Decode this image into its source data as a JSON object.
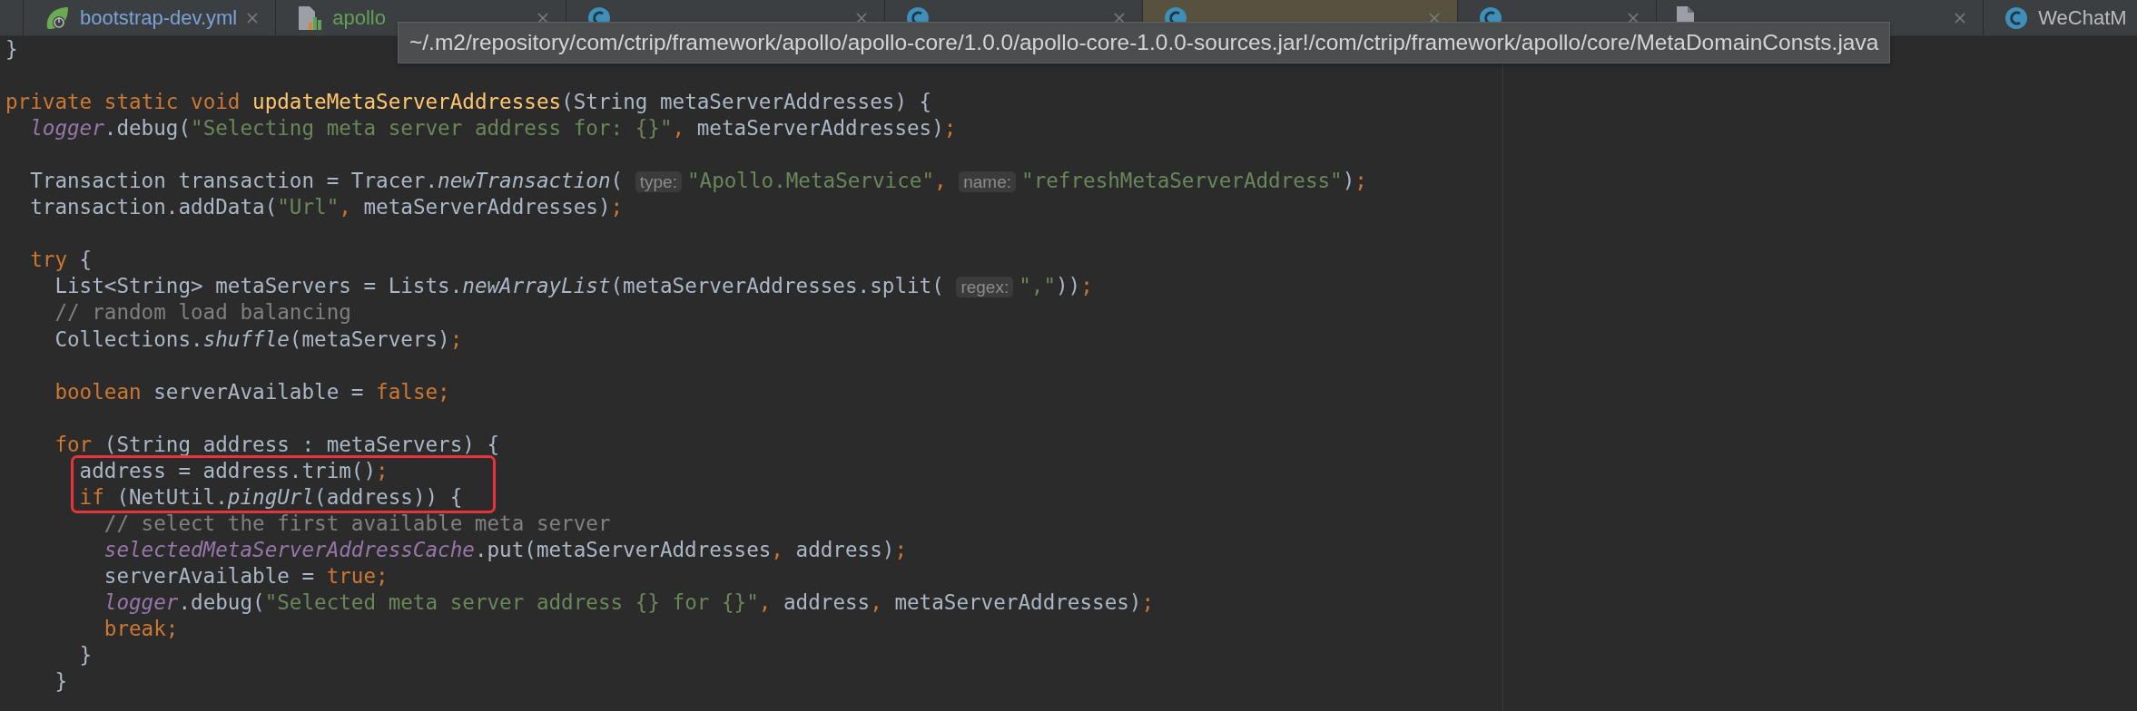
{
  "tabs": [
    {
      "label": "bootstrap-dev.yml",
      "kind": "spring",
      "color": "#7aa2d6",
      "selected": false
    },
    {
      "label": "apollo",
      "kind": "properties",
      "color": "#62a05a",
      "selected": false
    },
    {
      "kind": "class",
      "selected": false
    },
    {
      "kind": "class",
      "selected": false
    },
    {
      "kind": "class",
      "selected": true
    },
    {
      "kind": "class",
      "selected": false
    },
    {
      "kind": "xml",
      "selected": false
    },
    {
      "label": "WeChatM",
      "kind": "class",
      "color": "#bbbbbb",
      "selected": false
    }
  ],
  "tooltip": {
    "text": "~/.m2/repository/com/ctrip/framework/apollo/apollo-core/1.0.0/apollo-core-1.0.0-sources.jar!/com/ctrip/framework/apollo/core/MetaDomainConsts.java"
  },
  "code": {
    "lines": [
      {
        "highlighted": false,
        "tokens": [
          {
            "kind": "plain",
            "text": "}"
          }
        ]
      },
      {
        "highlighted": false
      },
      {
        "highlighted": false,
        "tokens": [
          {
            "kind": "kw",
            "text": "private static void "
          },
          {
            "kind": "decl",
            "text": "updateMetaServerAddresses"
          },
          {
            "kind": "plain",
            "text": "(String metaServerAddresses) {"
          }
        ],
        "children": [
          {
            "highlighted": false,
            "tokens": [
              {
                "kind": "field",
                "text": "logger"
              },
              {
                "kind": "plain",
                "text": ".debug("
              },
              {
                "kind": "str",
                "text": "\"Selecting meta server address for: {}\""
              },
              {
                "kind": "kw",
                "text": ", "
              },
              {
                "kind": "plain",
                "text": "metaServerAddresses)"
              },
              {
                "kind": "kw",
                "text": ";"
              }
            ]
          },
          {
            "highlighted": false
          },
          {
            "highlighted": false,
            "tokens": [
              {
                "kind": "plain",
                "text": "Transaction transaction = Tracer."
              },
              {
                "kind": "static",
                "text": "newTransaction"
              },
              {
                "kind": "plain",
                "text": "( "
              },
              {
                "kind": "hint",
                "text": "type:"
              },
              {
                "kind": "str",
                "text": "\"Apollo.MetaService\""
              },
              {
                "kind": "kw",
                "text": ", "
              },
              {
                "kind": "hint",
                "text": "name:"
              },
              {
                "kind": "str",
                "text": "\"refreshMetaServerAddress\""
              },
              {
                "kind": "plain",
                "text": ")"
              },
              {
                "kind": "kw",
                "text": ";"
              }
            ]
          },
          {
            "highlighted": false,
            "tokens": [
              {
                "kind": "plain",
                "text": "transaction.addData("
              },
              {
                "kind": "str",
                "text": "\"Url\""
              },
              {
                "kind": "kw",
                "text": ", "
              },
              {
                "kind": "plain",
                "text": "metaServerAddresses)"
              },
              {
                "kind": "kw",
                "text": ";"
              }
            ]
          },
          {
            "highlighted": false
          },
          {
            "highlighted": false,
            "tokens": [
              {
                "kind": "kw",
                "text": "try "
              },
              {
                "kind": "plain",
                "text": "{"
              }
            ],
            "children": [
              {
                "highlighted": false,
                "tokens": [
                  {
                    "kind": "plain",
                    "text": "List<String> metaServers = Lists."
                  },
                  {
                    "kind": "static",
                    "text": "newArrayList"
                  },
                  {
                    "kind": "plain",
                    "text": "(metaServerAddresses.split( "
                  },
                  {
                    "kind": "hint",
                    "text": "regex:"
                  },
                  {
                    "kind": "str",
                    "text": "\",\""
                  },
                  {
                    "kind": "plain",
                    "text": "))"
                  },
                  {
                    "kind": "kw",
                    "text": ";"
                  }
                ]
              },
              {
                "highlighted": false,
                "tokens": [
                  {
                    "kind": "comment",
                    "text": "// random load balancing"
                  }
                ]
              },
              {
                "highlighted": false,
                "tokens": [
                  {
                    "kind": "plain",
                    "text": "Collections."
                  },
                  {
                    "kind": "static",
                    "text": "shuffle"
                  },
                  {
                    "kind": "plain",
                    "text": "(metaServers)"
                  },
                  {
                    "kind": "kw",
                    "text": ";"
                  }
                ]
              },
              {
                "highlighted": false
              },
              {
                "highlighted": false,
                "tokens": [
                  {
                    "kind": "kw",
                    "text": "boolean "
                  },
                  {
                    "kind": "plain",
                    "text": "serverAvailable = "
                  },
                  {
                    "kind": "kw",
                    "text": "false;"
                  }
                ]
              },
              {
                "highlighted": false
              },
              {
                "highlighted": false,
                "tokens": [
                  {
                    "kind": "kw",
                    "text": "for "
                  },
                  {
                    "kind": "plain",
                    "text": "(String address : metaServers) {"
                  }
                ],
                "children": [
                  {
                    "highlighted": true,
                    "tokens": [
                      {
                        "kind": "plain",
                        "text": "address = address.trim()"
                      },
                      {
                        "kind": "kw",
                        "text": ";"
                      }
                    ]
                  },
                  {
                    "highlighted": true,
                    "tokens": [
                      {
                        "kind": "kw",
                        "text": "if "
                      },
                      {
                        "kind": "plain",
                        "text": "(NetUtil."
                      },
                      {
                        "kind": "static",
                        "text": "pingUrl"
                      },
                      {
                        "kind": "plain",
                        "text": "(address)) {"
                      }
                    ],
                    "children": [
                      {
                        "highlighted": false,
                        "tokens": [
                          {
                            "kind": "comment",
                            "text": "// select the first available meta server"
                          }
                        ]
                      },
                      {
                        "highlighted": false,
                        "tokens": [
                          {
                            "kind": "field",
                            "text": "selectedMetaServerAddressCache"
                          },
                          {
                            "kind": "plain",
                            "text": ".put(metaServerAddresses"
                          },
                          {
                            "kind": "kw",
                            "text": ", "
                          },
                          {
                            "kind": "plain",
                            "text": "address)"
                          },
                          {
                            "kind": "kw",
                            "text": ";"
                          }
                        ]
                      },
                      {
                        "highlighted": false,
                        "tokens": [
                          {
                            "kind": "plain",
                            "text": "serverAvailable = "
                          },
                          {
                            "kind": "kw",
                            "text": "true;"
                          }
                        ]
                      },
                      {
                        "highlighted": false,
                        "tokens": [
                          {
                            "kind": "field",
                            "text": "logger"
                          },
                          {
                            "kind": "plain",
                            "text": ".debug("
                          },
                          {
                            "kind": "str",
                            "text": "\"Selected meta server address {} for {}\""
                          },
                          {
                            "kind": "kw",
                            "text": ", "
                          },
                          {
                            "kind": "plain",
                            "text": "address"
                          },
                          {
                            "kind": "kw",
                            "text": ", "
                          },
                          {
                            "kind": "plain",
                            "text": "metaServerAddresses)"
                          },
                          {
                            "kind": "kw",
                            "text": ";"
                          }
                        ]
                      },
                      {
                        "highlighted": false,
                        "tokens": [
                          {
                            "kind": "kw",
                            "text": "break;"
                          }
                        ]
                      }
                    ]
                  },
                  {
                    "highlighted": false,
                    "tokens": [
                      {
                        "kind": "plain",
                        "text": "}"
                      }
                    ]
                  }
                ]
              },
              {
                "highlighted": false,
                "tokens": [
                  {
                    "kind": "plain",
                    "text": "}"
                  }
                ]
              }
            ]
          }
        ]
      }
    ]
  }
}
